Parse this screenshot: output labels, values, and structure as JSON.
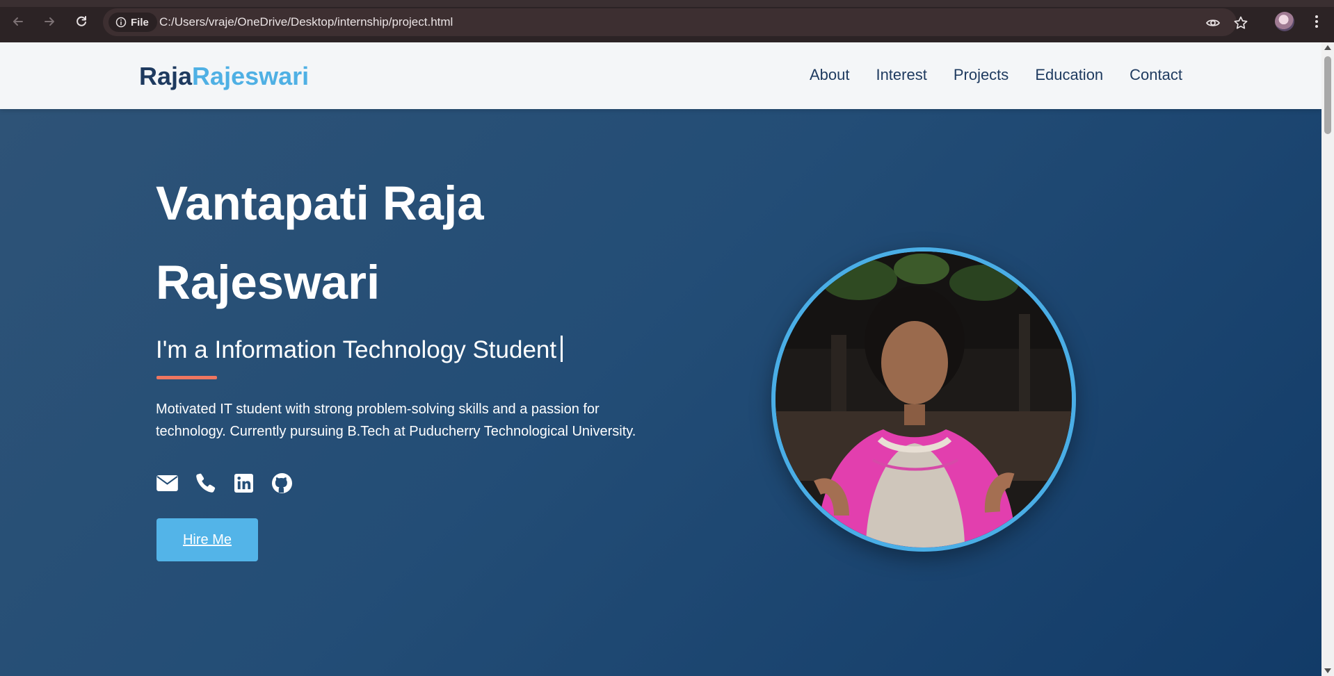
{
  "browser": {
    "scheme_chip": "File",
    "url": "C:/Users/vraje/OneDrive/Desktop/internship/project.html"
  },
  "header": {
    "logo_first": "Raja",
    "logo_second": "Rajeswari",
    "nav": [
      "About",
      "Interest",
      "Projects",
      "Education",
      "Contact"
    ]
  },
  "hero": {
    "name_line1": "Vantapati Raja",
    "name_line2": "Rajeswari",
    "tagline": "I'm a Information Technology Student",
    "description": "Motivated IT student with strong problem-solving skills and a passion for technology. Currently pursuing B.Tech at Puducherry Technological University.",
    "social_icons": [
      "envelope-icon",
      "phone-icon",
      "linkedin-icon",
      "github-icon"
    ],
    "cta_label": "Hire Me"
  },
  "colors": {
    "logo_dark": "#1e3a5f",
    "logo_accent": "#4fb0e4",
    "accent_line": "#ef7660",
    "button": "#53b4e8",
    "hero_bg": "#234d76"
  }
}
